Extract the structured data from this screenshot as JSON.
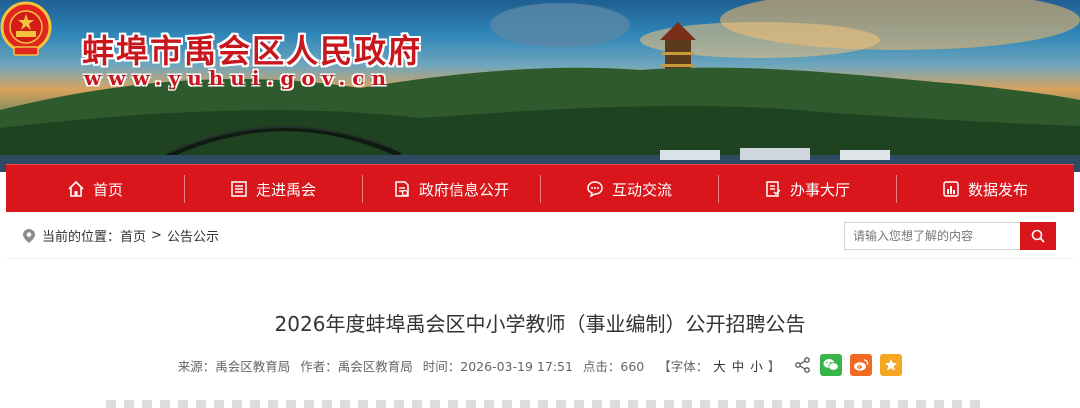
{
  "header": {
    "site_name": "蚌埠市禹会区人民政府",
    "site_url": "www.yuhui.gov.cn"
  },
  "nav": {
    "items": [
      {
        "label": "首页",
        "icon": "home-icon"
      },
      {
        "label": "走进禹会",
        "icon": "list-icon"
      },
      {
        "label": "政府信息公开",
        "icon": "document-icon"
      },
      {
        "label": "互动交流",
        "icon": "chat-icon"
      },
      {
        "label": "办事大厅",
        "icon": "service-document-icon"
      },
      {
        "label": "数据发布",
        "icon": "bar-chart-icon"
      }
    ]
  },
  "breadcrumb": {
    "prefix": "当前的位置：",
    "items": [
      "首页",
      "公告公示"
    ],
    "separator": ">"
  },
  "search": {
    "placeholder": "请输入您想了解的内容"
  },
  "article": {
    "title": "2026年度蚌埠禹会区中小学教师（事业编制）公开招聘公告",
    "meta": {
      "source": "来源：禹会区教育局",
      "author": "作者：禹会区教育局",
      "time": "时间：2026-03-19 17:51",
      "clicks": "点击：660",
      "font_size_prefix": "【字体：",
      "font_size_large": "大",
      "font_size_medium": "中",
      "font_size_small": "小",
      "font_size_suffix": "】"
    }
  },
  "colors": {
    "accent_red": "#d9161b",
    "title_red": "#c8161d",
    "wechat_green": "#38b54a",
    "weibo_orange": "#f26a22",
    "favorite_orange": "#f5a623"
  }
}
